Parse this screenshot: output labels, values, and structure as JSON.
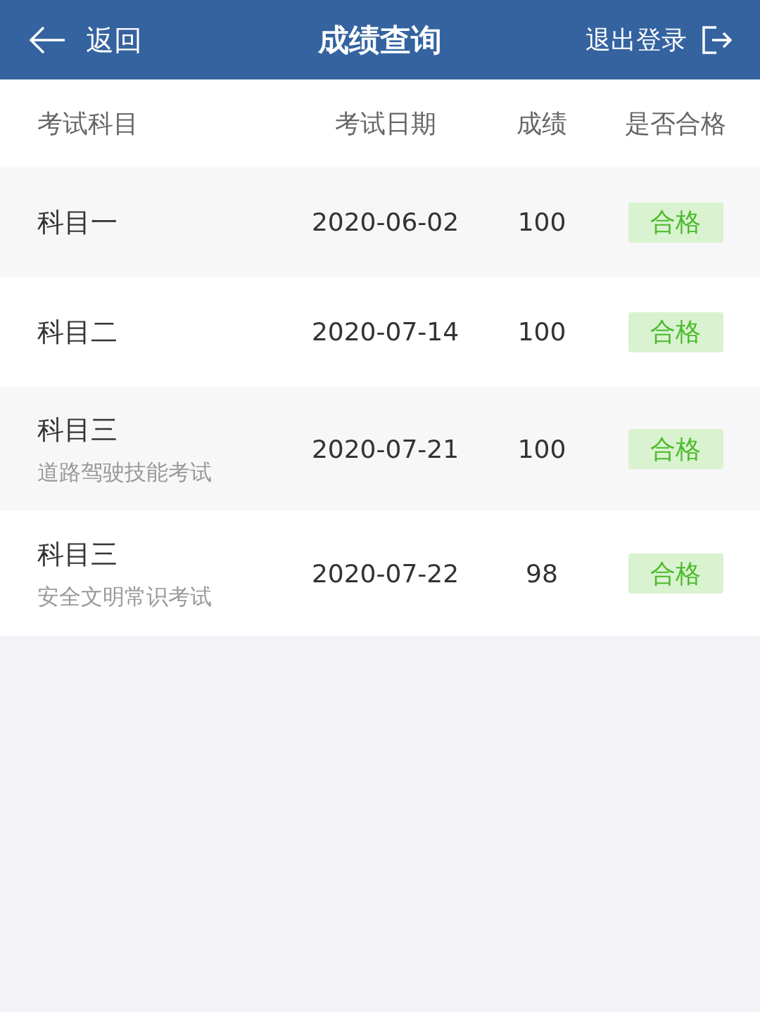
{
  "nav_bar": {
    "back": "返回",
    "title": "成绩查询",
    "logout": "退出登录"
  },
  "table": {
    "columns": [
      "考试科目",
      "考试日期",
      "成绩",
      "是否合格"
    ],
    "rows": [
      {
        "subject": "科目一",
        "date": "2020-06-02",
        "score": "100",
        "result": "合格",
        "passed": true
      },
      {
        "subject": "科目二",
        "date": "2020-07-14",
        "score": "100",
        "result": "合格",
        "passed": true
      },
      {
        "subject": "科目三",
        "subtitle": "道路驾驶技能考试",
        "date": "2020-07-21",
        "score": "100",
        "result": "合格",
        "passed": true
      },
      {
        "subject": "科目三",
        "subtitle": "安全文明常识考试",
        "date": "2020-07-22",
        "score": "98",
        "result": "合格",
        "passed": true
      }
    ]
  }
}
